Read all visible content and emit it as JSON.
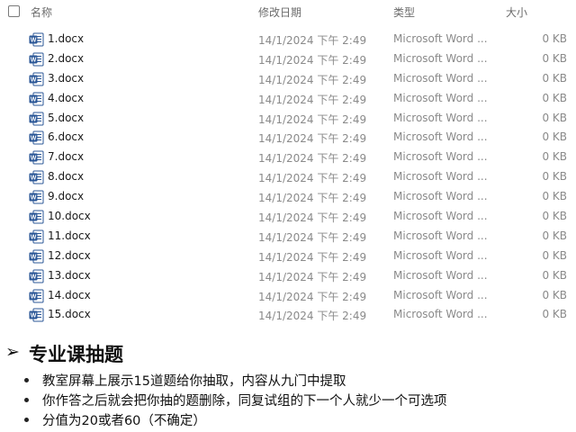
{
  "explorer": {
    "columns": {
      "name": "名称",
      "date": "修改日期",
      "type": "类型",
      "size": "大小"
    },
    "files": [
      {
        "name": "1.docx",
        "date": "14/1/2024 下午 2:49",
        "type": "Microsoft Word ...",
        "size": "0 KB"
      },
      {
        "name": "2.docx",
        "date": "14/1/2024 下午 2:49",
        "type": "Microsoft Word ...",
        "size": "0 KB"
      },
      {
        "name": "3.docx",
        "date": "14/1/2024 下午 2:49",
        "type": "Microsoft Word ...",
        "size": "0 KB"
      },
      {
        "name": "4.docx",
        "date": "14/1/2024 下午 2:49",
        "type": "Microsoft Word ...",
        "size": "0 KB"
      },
      {
        "name": "5.docx",
        "date": "14/1/2024 下午 2:49",
        "type": "Microsoft Word ...",
        "size": "0 KB"
      },
      {
        "name": "6.docx",
        "date": "14/1/2024 下午 2:49",
        "type": "Microsoft Word ...",
        "size": "0 KB"
      },
      {
        "name": "7.docx",
        "date": "14/1/2024 下午 2:49",
        "type": "Microsoft Word ...",
        "size": "0 KB"
      },
      {
        "name": "8.docx",
        "date": "14/1/2024 下午 2:49",
        "type": "Microsoft Word ...",
        "size": "0 KB"
      },
      {
        "name": "9.docx",
        "date": "14/1/2024 下午 2:49",
        "type": "Microsoft Word ...",
        "size": "0 KB"
      },
      {
        "name": "10.docx",
        "date": "14/1/2024 下午 2:49",
        "type": "Microsoft Word ...",
        "size": "0 KB"
      },
      {
        "name": "11.docx",
        "date": "14/1/2024 下午 2:49",
        "type": "Microsoft Word ...",
        "size": "0 KB"
      },
      {
        "name": "12.docx",
        "date": "14/1/2024 下午 2:49",
        "type": "Microsoft Word ...",
        "size": "0 KB"
      },
      {
        "name": "13.docx",
        "date": "14/1/2024 下午 2:49",
        "type": "Microsoft Word ...",
        "size": "0 KB"
      },
      {
        "name": "14.docx",
        "date": "14/1/2024 下午 2:49",
        "type": "Microsoft Word ...",
        "size": "0 KB"
      },
      {
        "name": "15.docx",
        "date": "14/1/2024 下午 2:49",
        "type": "Microsoft Word ...",
        "size": "0 KB"
      }
    ],
    "file_icon": "word-document-icon",
    "colors": {
      "word_blue": "#2b5797",
      "muted_text": "#8a8a8a"
    }
  },
  "slide": {
    "arrow": "➢",
    "title": "专业课抽题",
    "bullets": [
      "教室屏幕上展示15道题给你抽取，内容从九门中提取",
      "你作答之后就会把你抽的题删除，同复试组的下一个人就少一个可选项",
      "分值为20或者60（不确定）"
    ]
  }
}
